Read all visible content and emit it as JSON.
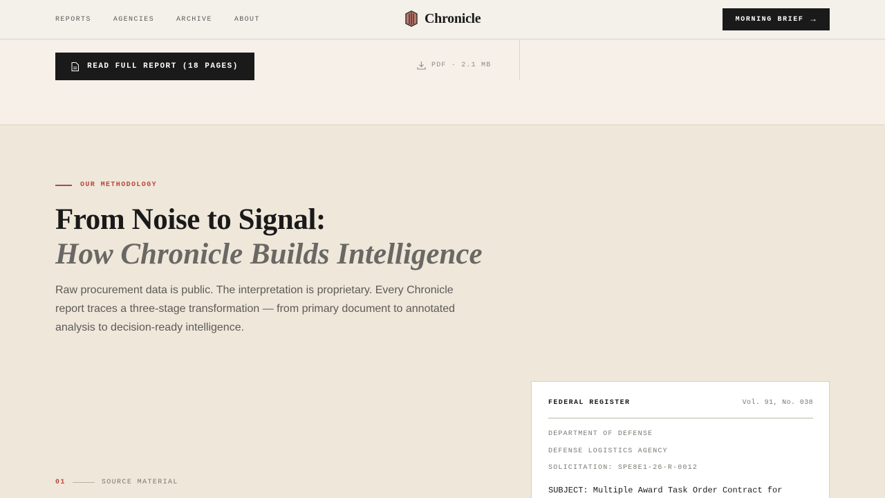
{
  "header": {
    "nav": [
      "REPORTS",
      "AGENCIES",
      "ARCHIVE",
      "ABOUT"
    ],
    "brand": "Chronicle",
    "cta_label": "MORNING BRIEF",
    "brand_colors": {
      "mark_fill": "#c0786a",
      "mark_stroke": "#2a2a2a"
    }
  },
  "report": {
    "read_label": "READ FULL REPORT (18 PAGES)",
    "pdf_meta": "PDF · 2.1 MB"
  },
  "methodology": {
    "eyebrow": "OUR METHODOLOGY",
    "title": "From Noise to Signal:",
    "subtitle": "How Chronicle Builds Intelligence",
    "lead": "Raw procurement data is public. The interpretation is proprietary. Every Chronicle report traces a three-stage transformation — from primary document to annotated analysis to decision-ready intelligence."
  },
  "step": {
    "number": "01",
    "label": "SOURCE MATERIAL"
  },
  "card": {
    "title": "FEDERAL REGISTER",
    "volume": "Vol. 91, No. 038",
    "lines": [
      "DEPARTMENT OF DEFENSE",
      "DEFENSE LOGISTICS AGENCY",
      "SOLICITATION: SPE8E1-26-R-0012"
    ],
    "subject": "SUBJECT: Multiple Award Task Order Contract for"
  },
  "colors": {
    "accent": "#b5473a",
    "ink": "#1a1a1a",
    "paper": "#efe7da"
  }
}
